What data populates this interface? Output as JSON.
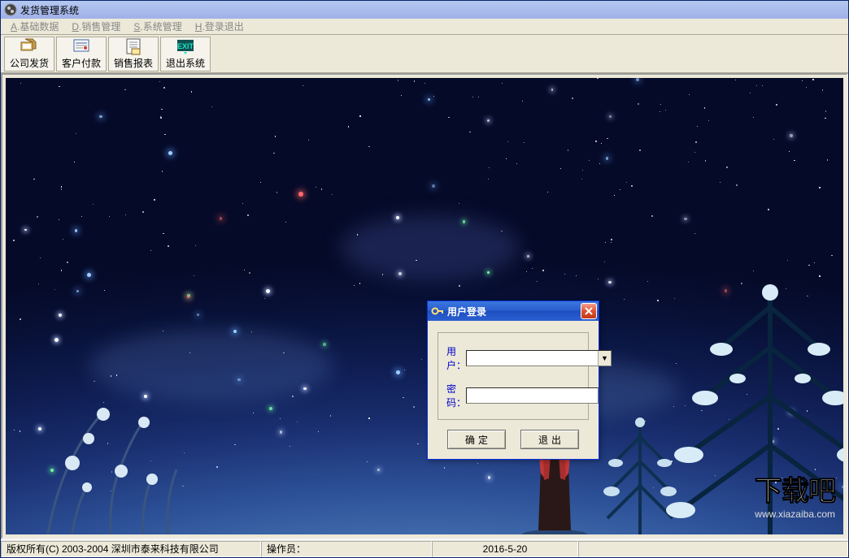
{
  "titlebar": {
    "title": "发货管理系统"
  },
  "menu": {
    "items": [
      {
        "hotkey": "A",
        "label": "基础数据"
      },
      {
        "hotkey": "D",
        "label": "销售管理"
      },
      {
        "hotkey": "S",
        "label": "系统管理"
      },
      {
        "hotkey": "H",
        "label": "登录退出"
      }
    ]
  },
  "toolbar": {
    "buttons": [
      {
        "name": "company-ship",
        "label": "公司发货"
      },
      {
        "name": "customer-pay",
        "label": "客户付款"
      },
      {
        "name": "sales-report",
        "label": "销售报表"
      },
      {
        "name": "exit-system",
        "label": "退出系统"
      }
    ]
  },
  "login": {
    "title": "用户登录",
    "user_label": "用户：",
    "pass_label": "密码：",
    "user_value": "",
    "pass_value": "",
    "ok": "确定",
    "exit": "退出"
  },
  "statusbar": {
    "copyright": "版权所有(C) 2003-2004  深圳市泰来科技有限公司",
    "operator_label": "操作员：",
    "date": "2016-5-20"
  },
  "watermark": {
    "big": "下载吧",
    "url": "www.xiazaiba.com"
  }
}
